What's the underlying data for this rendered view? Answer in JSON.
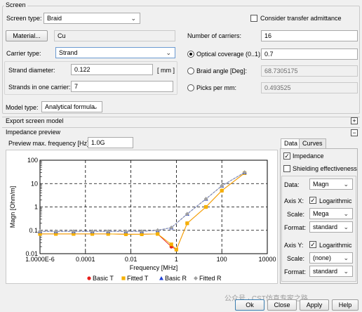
{
  "screen": {
    "title": "Screen",
    "screen_type_label": "Screen type:",
    "screen_type_value": "Braid",
    "consider_transfer_label": "Consider transfer admittance",
    "material_button": "Material...",
    "material_value": "Cu",
    "number_of_carriers_label": "Number of carriers:",
    "number_of_carriers_value": "16",
    "carrier_type_label": "Carrier type:",
    "carrier_type_value": "Strand",
    "optical_coverage_label": "Optical coverage (0..1):",
    "optical_coverage_value": "0.7",
    "strand_diameter_label": "Strand diameter:",
    "strand_diameter_value": "0.122",
    "strand_diameter_unit": "[ mm ]",
    "braid_angle_label": "Braid angle [Deg]:",
    "braid_angle_value": "68.7305175",
    "strands_label": "Strands in one carrier:",
    "strands_value": "7",
    "picks_label": "Picks per mm:",
    "picks_value": "0.493525"
  },
  "model": {
    "label": "Model type:",
    "value": "Analytical formula"
  },
  "export": {
    "label": "Export screen model",
    "toggle": "+"
  },
  "impedance": {
    "title": "Impedance preview",
    "toggle": "−",
    "preview_label": "Preview max. frequency [Hz]:",
    "preview_value": "1.0G"
  },
  "panel": {
    "tabs": [
      "Data",
      "Curves"
    ],
    "impedance_label": "Impedance",
    "shielding_label": "Shielding effectiveness",
    "data_label": "Data:",
    "data_value": "Magn",
    "axis_x_label": "Axis X:",
    "axis_x_log_label": "Logarithmic",
    "scale_label": "Scale:",
    "scale_x_value": "Mega",
    "format_label": "Format:",
    "format_x_value": "standard",
    "axis_y_label": "Axis Y:",
    "axis_y_log_label": "Logarithmic",
    "scale_y_value": "(none)",
    "format_y_value": "standard"
  },
  "buttons": {
    "ok": "Ok",
    "close": "Close",
    "apply": "Apply",
    "help": "Help"
  },
  "watermark": "公众号 · CST仿真专家之路",
  "chart_data": {
    "type": "line",
    "xlabel": "Frequency [MHz]",
    "ylabel": "Magn [Ohm/m]",
    "xscale": "log",
    "yscale": "log",
    "xlim": [
      1e-06,
      10000
    ],
    "ylim": [
      0.01,
      100
    ],
    "x_tick_labels": [
      "1.0000E-6",
      "0.0001",
      "0.01",
      "1",
      "100",
      "10000"
    ],
    "y_tick_labels": [
      "100",
      "10",
      "1",
      "0.1",
      "0.01"
    ],
    "grid": true,
    "legend_position": "bottom",
    "series": [
      {
        "name": "Basic T",
        "color": "#e8201c",
        "marker": "circle",
        "x": [
          1e-06,
          5e-06,
          3e-05,
          0.0002,
          0.001,
          0.006,
          0.03,
          0.15,
          0.6,
          1,
          3,
          20,
          100,
          1000
        ],
        "y": [
          0.07,
          0.07,
          0.07,
          0.07,
          0.07,
          0.068,
          0.068,
          0.07,
          0.02,
          0.015,
          0.2,
          1.0,
          5,
          28
        ]
      },
      {
        "name": "Fitted T",
        "color": "#f5b000",
        "marker": "square",
        "x": [
          1e-06,
          5e-06,
          3e-05,
          0.0002,
          0.001,
          0.006,
          0.03,
          0.15,
          0.6,
          1,
          3,
          20,
          100,
          1000
        ],
        "y": [
          0.07,
          0.07,
          0.07,
          0.07,
          0.07,
          0.068,
          0.068,
          0.07,
          0.025,
          0.015,
          0.2,
          1.0,
          5,
          28
        ]
      },
      {
        "name": "Basic R",
        "color": "#1c3fd6",
        "marker": "triangle",
        "x": [
          1e-06,
          5e-06,
          3e-05,
          0.0002,
          0.001,
          0.006,
          0.03,
          0.15,
          0.6,
          3,
          20,
          100,
          1000
        ],
        "y": [
          0.09,
          0.09,
          0.09,
          0.09,
          0.09,
          0.09,
          0.09,
          0.1,
          0.13,
          0.5,
          2.2,
          8,
          30
        ]
      },
      {
        "name": "Fitted R",
        "color": "#a0a0a0",
        "marker": "diamond",
        "x": [
          1e-06,
          5e-06,
          3e-05,
          0.0002,
          0.001,
          0.006,
          0.03,
          0.15,
          0.6,
          3,
          20,
          100,
          1000
        ],
        "y": [
          0.09,
          0.09,
          0.09,
          0.09,
          0.09,
          0.09,
          0.09,
          0.1,
          0.13,
          0.5,
          2.2,
          8,
          30
        ]
      }
    ]
  }
}
